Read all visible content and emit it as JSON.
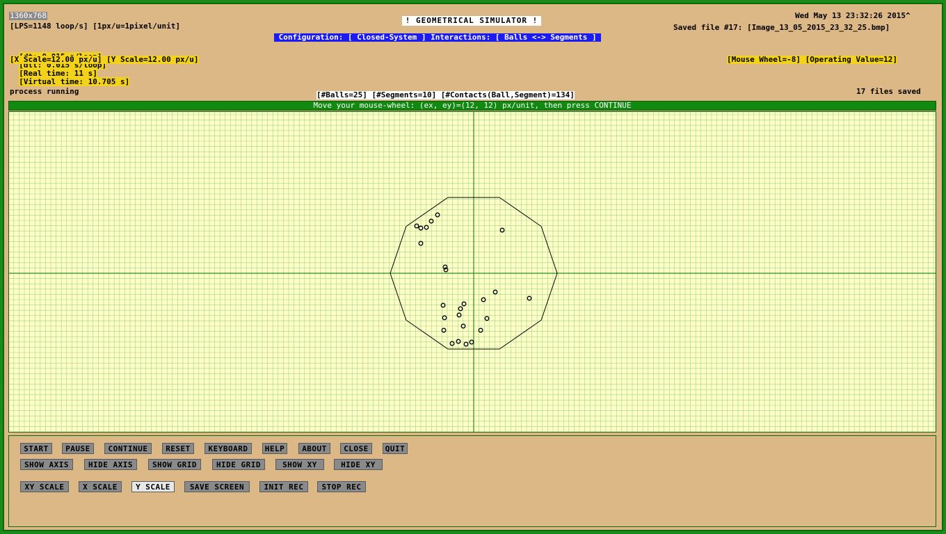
{
  "screen_size_tag": "1360x768",
  "title": "! GEOMETRICAL SIMULATOR !",
  "datetime": "Wed May 13 23:32:26 2015^",
  "lps": "[LPS=1148 loop/s] [1px/u=1pixel/unit]",
  "saved_file": "Saved file #17: [Image_13_05_2015_23_32_25.bmp]",
  "configuration": " Configuration: [ Closed-System ] Interactions: [ Balls <-> Segments ] ",
  "times": {
    "dt": "[dt: 0.015 s/loop]",
    "dtt": "[dtt: 0.015 s/loop]",
    "real": "[Real time: 11 s]",
    "virtual": "[Virtual time: 10.705 s]"
  },
  "scales": "[X Scale=12.00 px/u] [Y Scale=12.00 px/u]",
  "mouse_wheel": "[Mouse Wheel=-8] [Operating Value=12]",
  "process_status": "process running",
  "counts": "[#Balls=25] [#Segments=10] [#Contacts(Ball,Segment)=134]",
  "files_saved": "17 files saved",
  "instruction": "Move your mouse-wheel: (ex, ey)=(12, 12) px/unit, then press CONTINUE",
  "colors": {
    "frame": "#1a8a1a",
    "panel": "#dcb887",
    "canvas": "#ffffc4",
    "grid": "#9ad09a",
    "axis": "#2a8a2a",
    "highlight_yellow": "#f2d21a",
    "highlight_blue": "#1c1cf0"
  },
  "buttons_row1": [
    "START",
    "PAUSE",
    "CONTINUE",
    "RESET",
    "KEYBOARD",
    "HELP",
    "ABOUT",
    "CLOSE",
    "QUIT"
  ],
  "buttons_row2": [
    "SHOW AXIS",
    "HIDE AXIS",
    "SHOW GRID",
    "HIDE GRID",
    "SHOW  XY",
    "HIDE  XY"
  ],
  "buttons_row3": [
    "XY SCALE",
    "X SCALE",
    "Y SCALE",
    "SAVE SCREEN",
    "INIT REC",
    "STOP REC"
  ],
  "active_button": "Y SCALE",
  "simulation": {
    "segment_count": 10,
    "ball_count": 25
  }
}
